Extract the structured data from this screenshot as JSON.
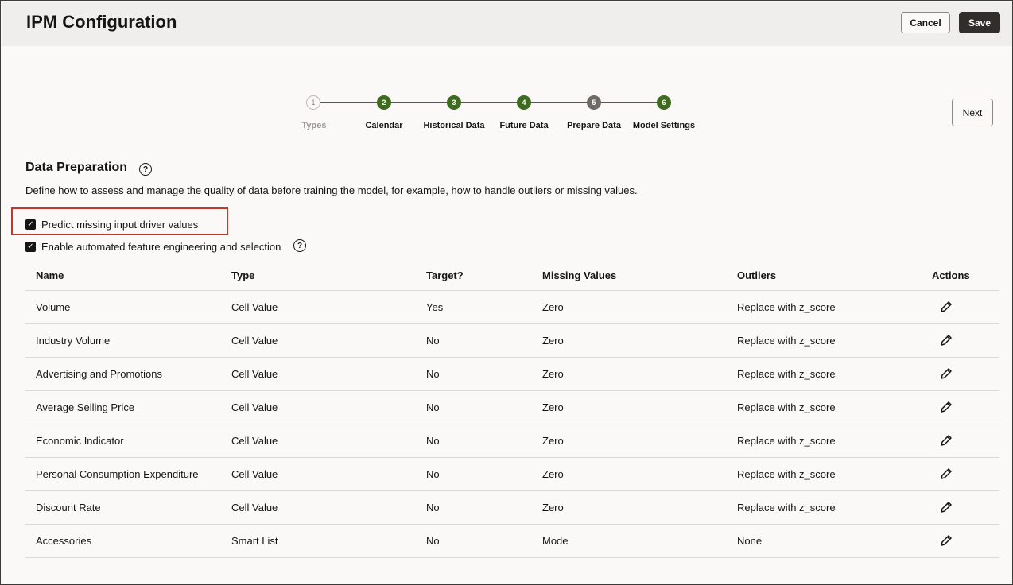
{
  "header": {
    "title": "IPM Configuration",
    "cancel_label": "Cancel",
    "save_label": "Save"
  },
  "stepper": {
    "next_label": "Next",
    "steps": [
      {
        "number": "1",
        "label": "Types",
        "state": "pending"
      },
      {
        "number": "2",
        "label": "Calendar",
        "state": "done"
      },
      {
        "number": "3",
        "label": "Historical Data",
        "state": "done"
      },
      {
        "number": "4",
        "label": "Future Data",
        "state": "done"
      },
      {
        "number": "5",
        "label": "Prepare Data",
        "state": "current"
      },
      {
        "number": "6",
        "label": "Model Settings",
        "state": "done"
      }
    ]
  },
  "section": {
    "title": "Data Preparation",
    "help_glyph": "?",
    "description": "Define how to assess and manage the quality of data before training the model, for example, how to handle outliers or missing values.",
    "checkboxes": [
      {
        "label": "Predict missing input driver values",
        "checked": true
      },
      {
        "label": "Enable automated feature engineering and selection",
        "checked": true
      }
    ]
  },
  "table": {
    "columns": [
      "Name",
      "Type",
      "Target?",
      "Missing Values",
      "Outliers",
      "Actions"
    ],
    "rows": [
      [
        "Volume",
        "Cell Value",
        "Yes",
        "Zero",
        "Replace with z_score"
      ],
      [
        "Industry Volume",
        "Cell Value",
        "No",
        "Zero",
        "Replace with z_score"
      ],
      [
        "Advertising and Promotions",
        "Cell Value",
        "No",
        "Zero",
        "Replace with z_score"
      ],
      [
        "Average Selling Price",
        "Cell Value",
        "No",
        "Zero",
        "Replace with z_score"
      ],
      [
        "Economic Indicator",
        "Cell Value",
        "No",
        "Zero",
        "Replace with z_score"
      ],
      [
        "Personal Consumption Expenditure",
        "Cell Value",
        "No",
        "Zero",
        "Replace with z_score"
      ],
      [
        "Discount Rate",
        "Cell Value",
        "No",
        "Zero",
        "Replace with z_score"
      ],
      [
        "Accessories",
        "Smart List",
        "No",
        "Mode",
        "None"
      ]
    ],
    "action_icon": "pencil-icon"
  },
  "colors": {
    "step_done": "#3e6b1f",
    "step_current": "#6f6a66",
    "highlight": "#c0392b",
    "save_bg": "#312d2a"
  }
}
